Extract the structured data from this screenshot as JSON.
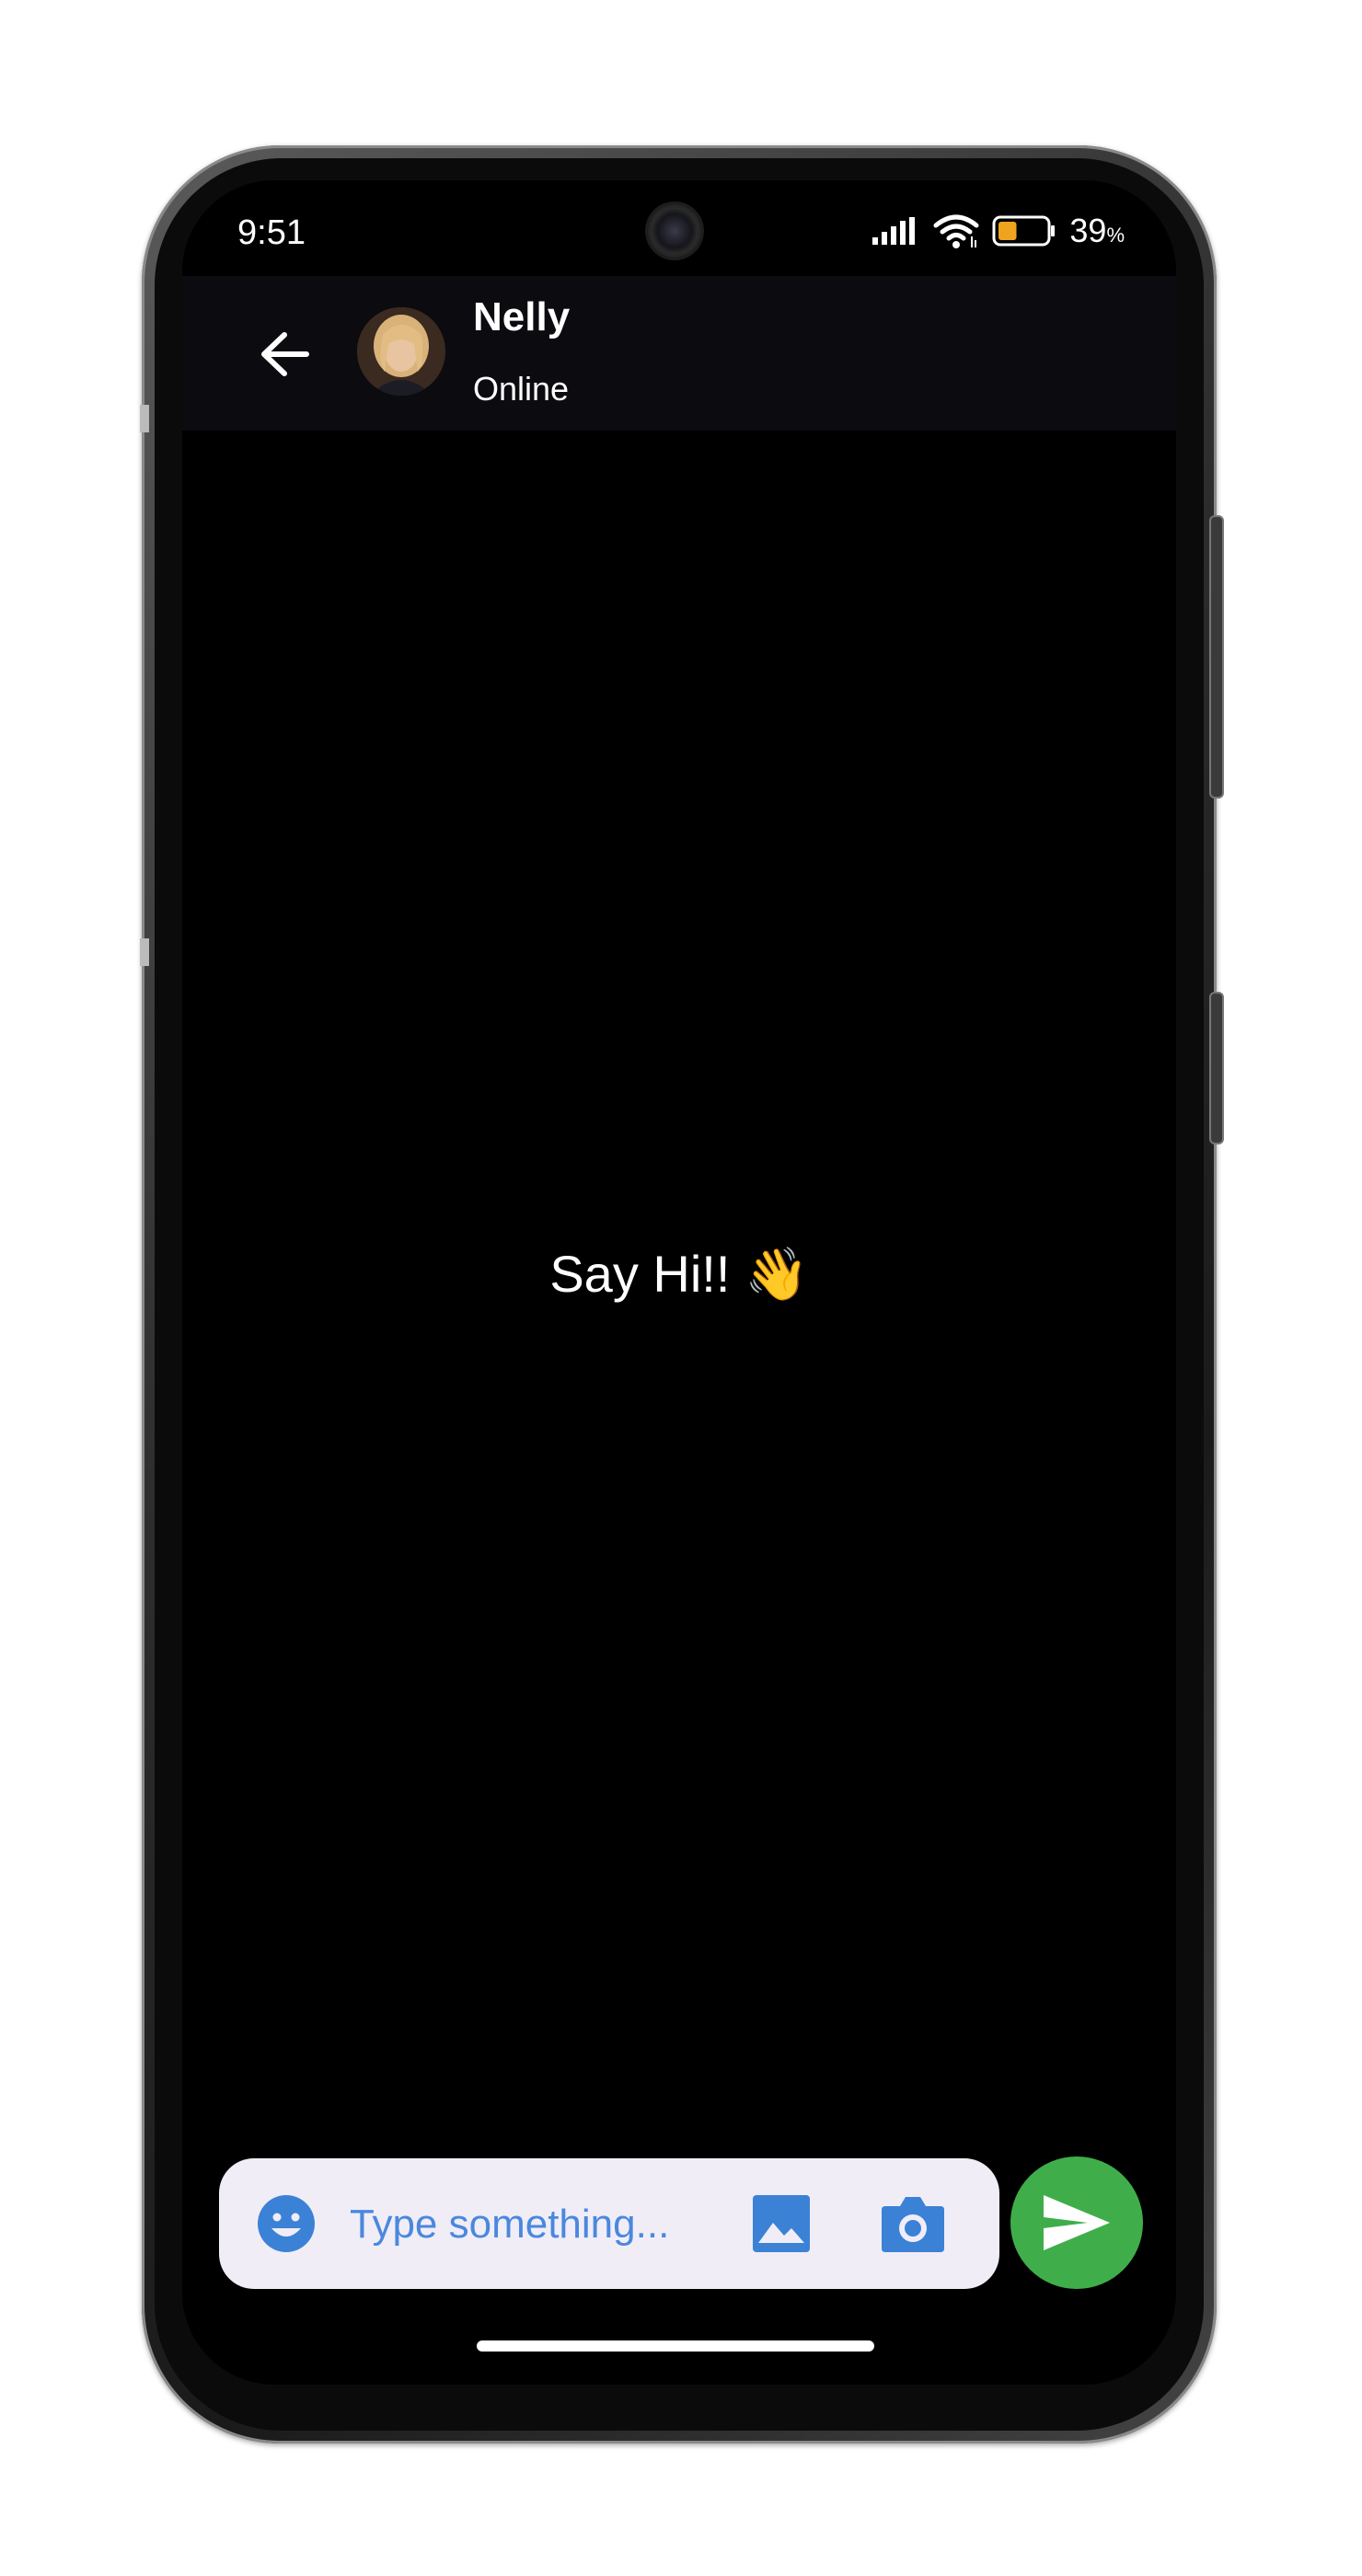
{
  "status_bar": {
    "time": "9:51",
    "battery_percent": "39",
    "battery_unit": "%",
    "battery_level": 0.39,
    "icons": [
      "signal-icon",
      "wifi-icon",
      "battery-icon"
    ]
  },
  "header": {
    "back_icon": "arrow-left-icon",
    "contact_name": "Nelly",
    "contact_status": "Online"
  },
  "chat": {
    "empty_text": "Say Hi!! 👋"
  },
  "composer": {
    "placeholder": "Type something...",
    "icons": [
      "emoji-icon",
      "image-icon",
      "camera-icon",
      "send-icon"
    ]
  },
  "colors": {
    "background": "#000000",
    "app_bar": "#0b0b10",
    "input_background": "#f1edf6",
    "accent_blue": "#3b82d6",
    "send_green": "#3fae4a",
    "battery_orange": "#f0a31e"
  }
}
